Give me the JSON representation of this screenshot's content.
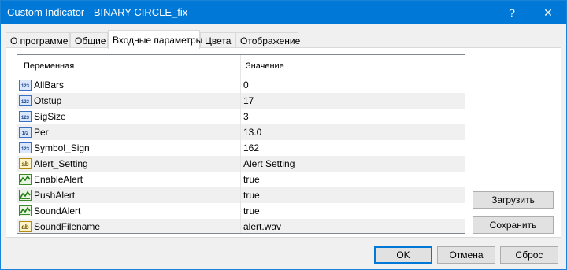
{
  "window": {
    "title": "Custom Indicator - BINARY CIRCLE_fix",
    "help_label": "?",
    "close_label": "✕"
  },
  "tabs": [
    {
      "label": "О программе"
    },
    {
      "label": "Общие"
    },
    {
      "label": "Входные параметры",
      "active": true
    },
    {
      "label": "Цвета"
    },
    {
      "label": "Отображение"
    }
  ],
  "grid": {
    "headers": {
      "variable": "Переменная",
      "value": "Значение"
    },
    "rows": [
      {
        "icon": "int",
        "name": "AllBars",
        "value": "0"
      },
      {
        "icon": "int",
        "name": "Otstup",
        "value": "17"
      },
      {
        "icon": "int",
        "name": "SigSize",
        "value": "3"
      },
      {
        "icon": "double",
        "name": "Per",
        "value": "13.0"
      },
      {
        "icon": "int",
        "name": "Symbol_Sign",
        "value": "162"
      },
      {
        "icon": "string",
        "name": "Alert_Setting",
        "value": "Alert Setting"
      },
      {
        "icon": "bool",
        "name": "EnableAlert",
        "value": "true"
      },
      {
        "icon": "bool",
        "name": "PushAlert",
        "value": "true"
      },
      {
        "icon": "bool",
        "name": "SoundAlert",
        "value": "true"
      },
      {
        "icon": "string",
        "name": "SoundFilename",
        "value": "alert.wav"
      }
    ]
  },
  "side_buttons": {
    "load": "Загрузить",
    "save": "Сохранить"
  },
  "footer": {
    "ok": "OK",
    "cancel": "Отмена",
    "reset": "Сброс"
  },
  "icon_text": {
    "int": "123",
    "double": "1/2",
    "string": "ab"
  },
  "colors": {
    "titlebar": "#0078d7",
    "accent": "#0078d7"
  }
}
